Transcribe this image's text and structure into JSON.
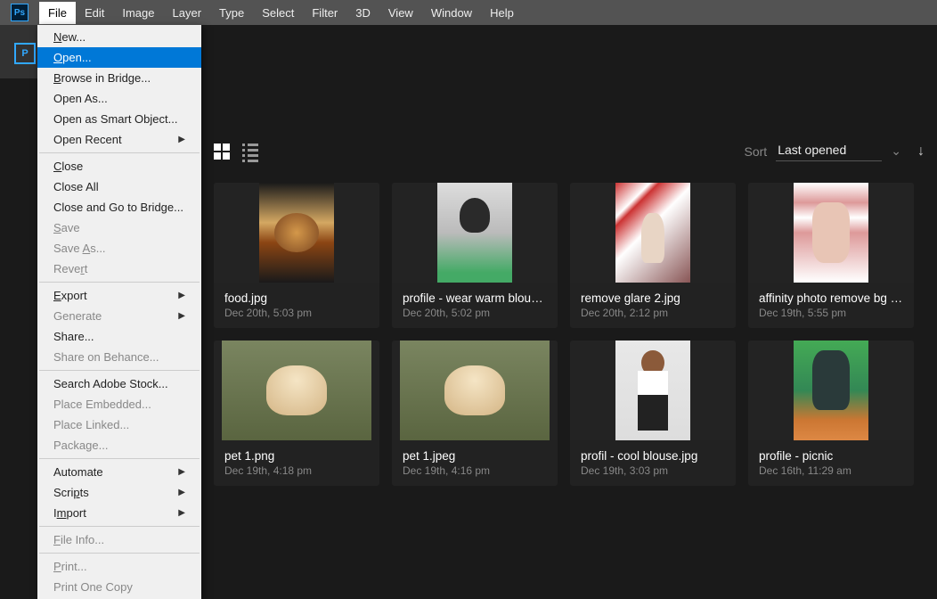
{
  "menubar": [
    "File",
    "Edit",
    "Image",
    "Layer",
    "Type",
    "Select",
    "Filter",
    "3D",
    "View",
    "Window",
    "Help"
  ],
  "dropdown": {
    "items": [
      {
        "label": "New...",
        "u": 0
      },
      {
        "label": "Open...",
        "u": 0,
        "hl": true
      },
      {
        "label": "Browse in Bridge...",
        "u": 0
      },
      {
        "label": "Open As..."
      },
      {
        "label": "Open as Smart Object..."
      },
      {
        "label": "Open Recent",
        "sub": true
      },
      {
        "sep": true
      },
      {
        "label": "Close",
        "u": 0
      },
      {
        "label": "Close All"
      },
      {
        "label": "Close and Go to Bridge..."
      },
      {
        "label": "Save",
        "u": 0,
        "disabled": true
      },
      {
        "label": "Save As...",
        "u": 5,
        "disabled": true
      },
      {
        "label": "Revert",
        "u": 4,
        "disabled": true
      },
      {
        "sep": true
      },
      {
        "label": "Export",
        "u": 0,
        "sub": true
      },
      {
        "label": "Generate",
        "disabled": true,
        "sub": true
      },
      {
        "label": "Share..."
      },
      {
        "label": "Share on Behance...",
        "disabled": true
      },
      {
        "sep": true
      },
      {
        "label": "Search Adobe Stock..."
      },
      {
        "label": "Place Embedded...",
        "disabled": true
      },
      {
        "label": "Place Linked...",
        "disabled": true
      },
      {
        "label": "Package...",
        "disabled": true
      },
      {
        "sep": true
      },
      {
        "label": "Automate",
        "sub": true
      },
      {
        "label": "Scripts",
        "u": 4,
        "sub": true
      },
      {
        "label": "Import",
        "u": 1,
        "sub": true
      },
      {
        "sep": true
      },
      {
        "label": "File Info...",
        "u": 0,
        "disabled": true
      },
      {
        "sep": true
      },
      {
        "label": "Print...",
        "u": 0,
        "disabled": true
      },
      {
        "label": "Print One Copy",
        "disabled": true
      }
    ]
  },
  "sort": {
    "label": "Sort",
    "value": "Last opened"
  },
  "files": [
    {
      "name": "food.jpg",
      "date": "Dec 20th, 5:03 pm",
      "thumb": "th-food",
      "wide": false
    },
    {
      "name": "profile - wear warm blous…",
      "date": "Dec 20th, 5:02 pm",
      "thumb": "th-profile1",
      "wide": false
    },
    {
      "name": "remove glare 2.jpg",
      "date": "Dec 20th, 2:12 pm",
      "thumb": "th-glare",
      "wide": false
    },
    {
      "name": "affinity photo remove bg 1…",
      "date": "Dec 19th, 5:55 pm",
      "thumb": "th-affinity",
      "wide": false
    },
    {
      "name": "pet 1.png",
      "date": "Dec 19th, 4:18 pm",
      "thumb": "th-pet",
      "wide": true
    },
    {
      "name": "pet 1.jpeg",
      "date": "Dec 19th, 4:16 pm",
      "thumb": "th-pet",
      "wide": true
    },
    {
      "name": "profil - cool blouse.jpg",
      "date": "Dec 19th, 3:03 pm",
      "thumb": "th-cool",
      "wide": false
    },
    {
      "name": "profile - picnic",
      "date": "Dec 16th, 11:29 am",
      "thumb": "th-picnic",
      "wide": false
    }
  ]
}
